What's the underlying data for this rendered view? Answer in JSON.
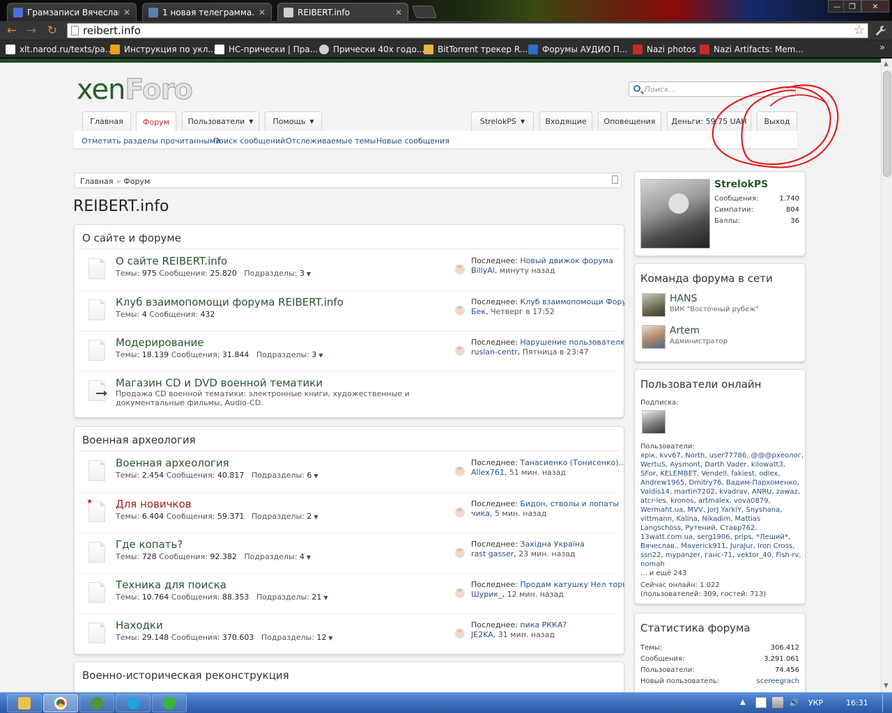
{
  "browser": {
    "tabs": [
      {
        "label": "Грамзаписи Вячеслава П",
        "color": "#4a6fd8"
      },
      {
        "label": "1 новая телеграмма.",
        "color": "#5b7fb0"
      },
      {
        "label": "REIBERT.info",
        "color": "#cfcfcf"
      }
    ],
    "url": "reibert.info",
    "bookmarks": [
      {
        "label": "xlt.narod.ru/texts/pa...",
        "color": "#ffffff"
      },
      {
        "label": "Инструкция по укл...",
        "color": "#e8a21b"
      },
      {
        "label": "НС-прически | Пра...",
        "color": "#ffffff"
      },
      {
        "label": "Прически 40х годо...",
        "color": "#d0d0d0"
      },
      {
        "label": "BitTorrent трекер R...",
        "color": "#e8b34a"
      },
      {
        "label": "Форумы АУДИО П...",
        "color": "#2f6dc9"
      },
      {
        "label": "Nazi photos",
        "color": "#c42b2b"
      },
      {
        "label": "Nazi Artifacts: Mem...",
        "color": "#c42b2b"
      }
    ]
  },
  "forum": {
    "logo_left": "xen",
    "logo_right": "Foro",
    "search_placeholder": "Поиск...",
    "nav_left": [
      {
        "label": "Главная",
        "active": false,
        "dropdown": false
      },
      {
        "label": "Форум",
        "active": true,
        "dropdown": false
      },
      {
        "label": "Пользователи",
        "active": false,
        "dropdown": true
      },
      {
        "label": "Помощь",
        "active": false,
        "dropdown": true
      }
    ],
    "nav_right": [
      {
        "label": "StrelokPS",
        "dropdown": true
      },
      {
        "label": "Входящие",
        "dropdown": false
      },
      {
        "label": "Оповещения",
        "dropdown": false
      },
      {
        "label": "Деньги: 59.75 UAH",
        "dropdown": false
      },
      {
        "label": "Выход",
        "dropdown": false
      }
    ],
    "subnav": [
      "Отметить разделы прочитанными",
      "Поиск сообщений",
      "Отслеживаемые темы",
      "Новые сообщения"
    ],
    "breadcrumb": [
      "Главная",
      "Форум"
    ],
    "breadcrumb_sep": "»",
    "page_title": "REIBERT.info",
    "stats_labels": {
      "threads": "Темы:",
      "messages": "Сообщения:",
      "subforums": "Подразделы:",
      "last": "Последнее:"
    },
    "categories": [
      {
        "title": "О сайте и форуме",
        "nodes": [
          {
            "name": "О сайте REIBERT.info",
            "threads": "975",
            "messages": "25.820",
            "subforums": "3",
            "last_title": "Новый движок форума",
            "last_user": "BillyAl",
            "last_time": "минуту назад"
          },
          {
            "name": "Клуб взаимопомощи форума REIBERT.info",
            "threads": "4",
            "messages": "432",
            "subforums": "",
            "last_title": "Клуб взаимопомощи Форума...",
            "last_user": "Бек",
            "last_time": "Четверг в 17:52"
          },
          {
            "name": "Модерирование",
            "threads": "18.139",
            "messages": "31.844",
            "subforums": "3",
            "last_title": "Нарушение пользователю...",
            "last_user": "ruslan-centr",
            "last_time": "Пятница в 23:47"
          },
          {
            "name": "Магазин CD и DVD военной тематики",
            "link": true,
            "desc": "Продажа CD военной тематики: электронные книги, художественные и документальные фильмы, Audio-CD."
          }
        ]
      },
      {
        "title": "Военная археология",
        "nodes": [
          {
            "name": "Военная археология",
            "threads": "2.454",
            "messages": "40.817",
            "subforums": "6",
            "last_title": "Танасиенко (Тонисенко)...",
            "last_user": "Allex761",
            "last_time": "51 мин. назад"
          },
          {
            "name": "Для новичков",
            "red": true,
            "threads": "6.404",
            "messages": "59.371",
            "subforums": "2",
            "last_title": "Бидон, стволы и лопаты",
            "last_user": "чика",
            "last_time": "5 мин. назад"
          },
          {
            "name": "Где копать?",
            "threads": "728",
            "messages": "92.382",
            "subforums": "4",
            "last_title": "Західна Україна",
            "last_user": "rast gasser",
            "last_time": "23 мин. назад"
          },
          {
            "name": "Техника для поиска",
            "threads": "10.764",
            "messages": "88.353",
            "subforums": "21",
            "last_title": "Продам катушку Нел торнадо.",
            "last_user": "Шурик_",
            "last_time": "12 мин. назад"
          },
          {
            "name": "Находки",
            "threads": "29.148",
            "messages": "370.603",
            "subforums": "12",
            "last_title": "пика РККА?",
            "last_user": "JE2KA",
            "last_time": "31 мин. назад"
          }
        ]
      },
      {
        "title": "Военно-историческая реконструкция",
        "nodes": []
      }
    ],
    "sidebar": {
      "visitor": {
        "name": "StrelokPS",
        "stats": [
          {
            "label": "Сообщения:",
            "value": "1.740"
          },
          {
            "label": "Симпатии:",
            "value": "804"
          },
          {
            "label": "Баллы:",
            "value": "36"
          }
        ]
      },
      "staff_title": "Команда форума в сети",
      "staff": [
        {
          "name": "HANS",
          "title": "ВИК \"Восточный рубеж\""
        },
        {
          "name": "Artem",
          "title": "Администратор"
        }
      ],
      "online_title": "Пользователи онлайн",
      "following_label": "Подписка:",
      "members_label": "Пользователи:",
      "members": "ярік, kvv67, North, user77786, @@@рхеолог, WertuS, Aysmont, Darth Vader, kilowatt3, SFor, KELEMBET, Vendell, fakiest, odlex, Andrew1965, Dmitry76, Вадим-Пархоменко, Valdis14, martin7202, kvadrav, ANRU, zawaz, atcr-les, kronos, artmalex, vova0879, Wermaht.ua, MVV, JorJ YarkiY, Snyshana, vittmann, Kalina, Nikadim, Mattias Langschoss, Рутений, Ставр762, 13watt.com.ua, serg1906, prips, *Леший*, Вячеслав., Maverick911, JuraJur, Iron Cross, ssn22, mypanzer, ганс-71, vektor_40, Fish-rv, nomah",
      "more": "... и ещё 243",
      "online_now": "Сейчас онлайн: 1.022",
      "online_breakdown": "(пользователей: 309, гостей: 713)",
      "stats_title": "Статистика форума",
      "stats": [
        {
          "label": "Темы:",
          "value": "306.412"
        },
        {
          "label": "Сообщения:",
          "value": "3.291.061"
        },
        {
          "label": "Пользователи:",
          "value": "74.456"
        },
        {
          "label": "Новый пользователь:",
          "value": "scereegrach"
        }
      ]
    }
  },
  "taskbar": {
    "lang": "УКР",
    "time": "16:31"
  },
  "colors": {
    "accent_green": "#2a5530",
    "link_blue": "#2a4f80",
    "annotation_red": "#e02020"
  }
}
